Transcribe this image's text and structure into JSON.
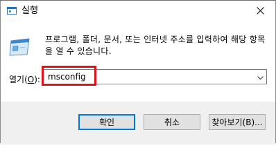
{
  "window": {
    "title": "실행",
    "close_symbol": "✕"
  },
  "dialog": {
    "description": "프로그램, 폴더, 문서, 또는 인터넷 주소를 입력하여 해당 항목을 열 수 있습니다.",
    "open_label_prefix": "열기(",
    "open_label_key": "O",
    "open_label_suffix": "):",
    "input_value": "msconfig"
  },
  "buttons": {
    "ok": "확인",
    "cancel": "취소",
    "browse": "찾아보기(B)..."
  },
  "icons": {
    "app": "run-app-icon",
    "run": "run-dialog-icon",
    "close": "close-icon",
    "dropdown": "chevron-down-icon"
  },
  "colors": {
    "highlight": "#e0101a",
    "default_button_border": "#0078d7",
    "footer_bg": "#f0f0f0"
  }
}
